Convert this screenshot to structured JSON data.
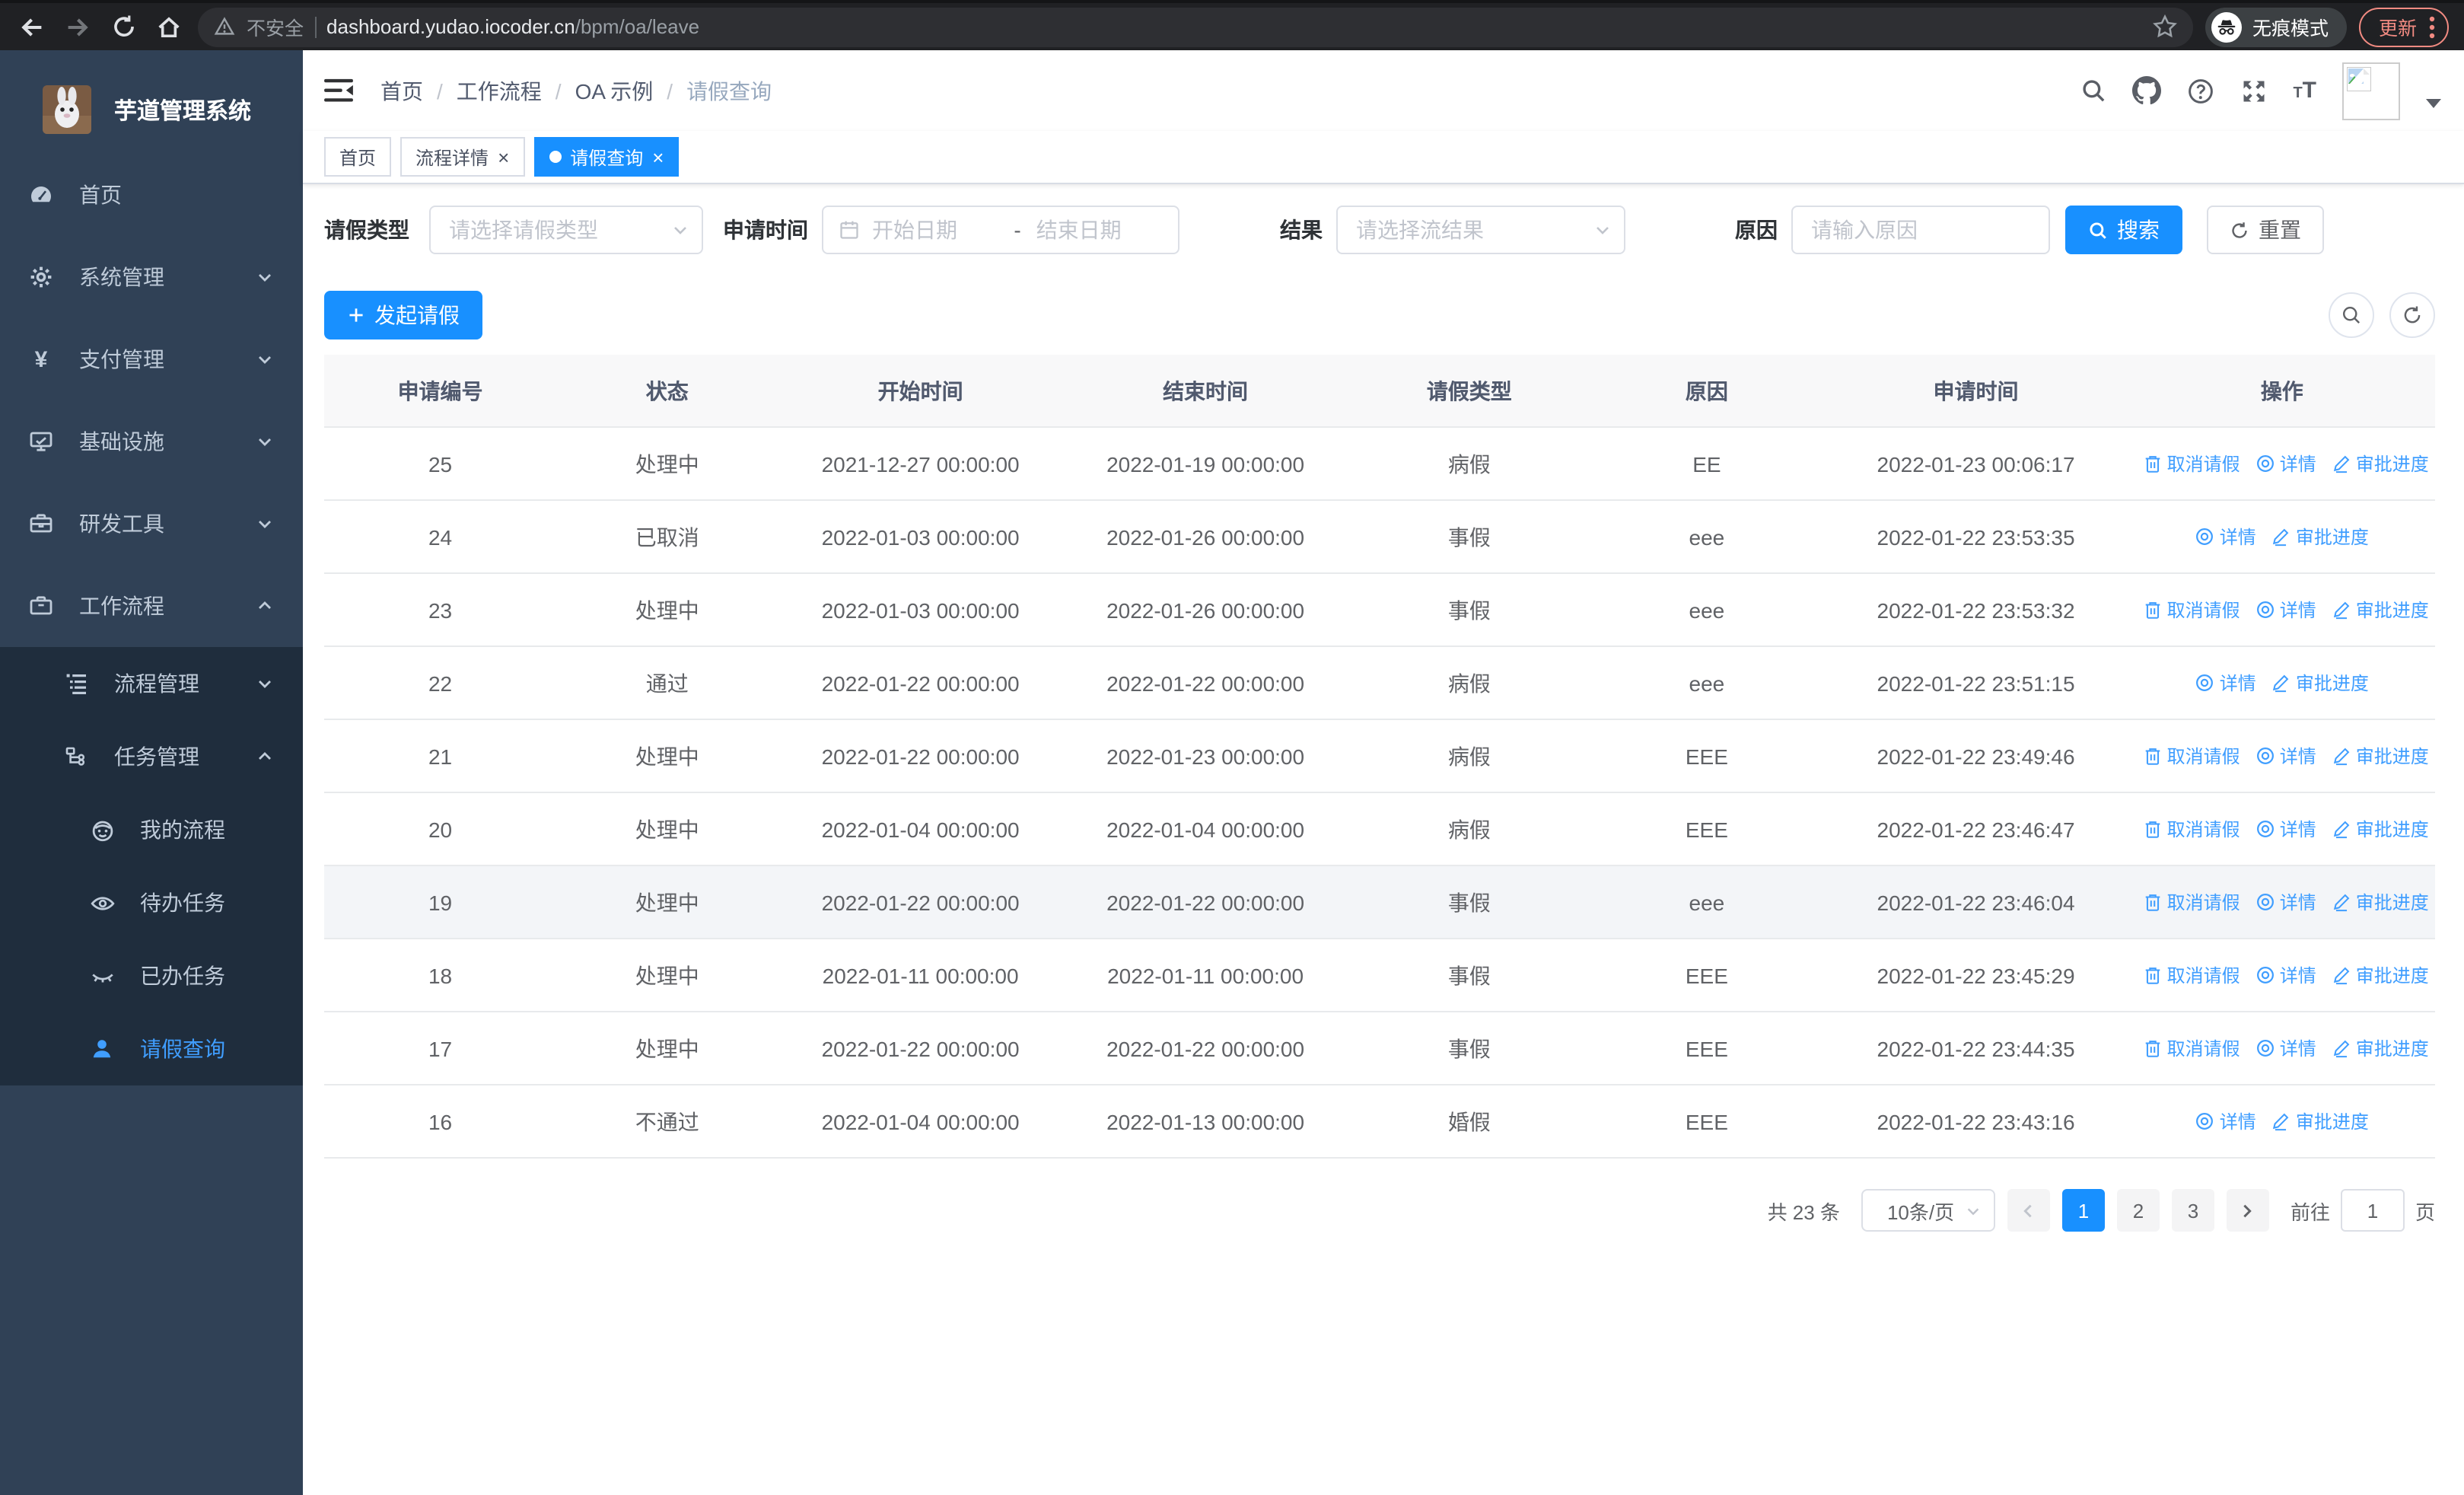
{
  "browser": {
    "security_label": "不安全",
    "url_host": "dashboard.yudao.iocoder.cn",
    "url_path": "/bpm/oa/leave",
    "incognito_label": "无痕模式",
    "update_label": "更新"
  },
  "colors": {
    "primary": "#1890ff",
    "link": "#409eff",
    "sidebar_bg": "#304156",
    "submenu_bg": "#1f2d3d",
    "sidebar_text": "#bfcbd9",
    "sidebar_active": "#409eff",
    "update_badge": "#f28b82",
    "table_header_bg": "#f8f8f9"
  },
  "sidebar": {
    "logo_title": "芋道管理系统",
    "menu": [
      {
        "key": "home",
        "label": "首页",
        "icon": "dashboard-icon",
        "level": 1
      },
      {
        "key": "system",
        "label": "系统管理",
        "icon": "gear-icon",
        "level": 1,
        "chevron": "down"
      },
      {
        "key": "payment",
        "label": "支付管理",
        "icon": "yen-icon",
        "level": 1,
        "chevron": "down"
      },
      {
        "key": "infra",
        "label": "基础设施",
        "icon": "monitor-icon",
        "level": 1,
        "chevron": "down"
      },
      {
        "key": "devtools",
        "label": "研发工具",
        "icon": "toolbox-icon",
        "level": 1,
        "chevron": "down"
      },
      {
        "key": "workflow",
        "label": "工作流程",
        "icon": "briefcase-icon",
        "level": 1,
        "chevron": "up"
      },
      {
        "key": "process-mgmt",
        "label": "流程管理",
        "icon": "list-icon",
        "level": 2,
        "sub": true,
        "chevron": "down"
      },
      {
        "key": "task-mgmt",
        "label": "任务管理",
        "icon": "tree-icon",
        "level": 2,
        "sub": true,
        "chevron": "up"
      },
      {
        "key": "my-process",
        "label": "我的流程",
        "icon": "robot-icon",
        "level": 3,
        "sub": true
      },
      {
        "key": "todo-tasks",
        "label": "待办任务",
        "icon": "eye-icon",
        "level": 3,
        "sub": true
      },
      {
        "key": "done-tasks",
        "label": "已办任务",
        "icon": "eye-closed-icon",
        "level": 3,
        "sub": true
      },
      {
        "key": "leave-query",
        "label": "请假查询",
        "icon": "user-icon",
        "level": 3,
        "sub": true,
        "active": true
      }
    ]
  },
  "header": {
    "breadcrumb": [
      "首页",
      "工作流程",
      "OA 示例",
      "请假查询"
    ]
  },
  "tabs": [
    {
      "label": "首页",
      "closable": false,
      "active": false
    },
    {
      "label": "流程详情",
      "closable": true,
      "active": false
    },
    {
      "label": "请假查询",
      "closable": true,
      "active": true
    }
  ],
  "filters": {
    "leave_type_label": "请假类型",
    "leave_type_placeholder": "请选择请假类型",
    "apply_time_label": "申请时间",
    "start_date_placeholder": "开始日期",
    "range_separator": "-",
    "end_date_placeholder": "结束日期",
    "result_label": "结果",
    "result_placeholder": "请选择流结果",
    "reason_label": "原因",
    "reason_placeholder": "请输入原因",
    "search_label": "搜索",
    "reset_label": "重置"
  },
  "toolbar": {
    "create_label": "发起请假"
  },
  "table": {
    "columns": [
      "申请编号",
      "状态",
      "开始时间",
      "结束时间",
      "请假类型",
      "原因",
      "申请时间",
      "操作"
    ],
    "action_labels": {
      "cancel": "取消请假",
      "detail": "详情",
      "progress": "审批进度"
    },
    "rows": [
      {
        "id": "25",
        "status": "处理中",
        "start": "2021-12-27 00:00:00",
        "end": "2022-01-19 00:00:00",
        "type": "病假",
        "reason": "EE",
        "apply_time": "2022-01-23 00:06:17",
        "actions": [
          "cancel",
          "detail",
          "progress"
        ]
      },
      {
        "id": "24",
        "status": "已取消",
        "start": "2022-01-03 00:00:00",
        "end": "2022-01-26 00:00:00",
        "type": "事假",
        "reason": "eee",
        "apply_time": "2022-01-22 23:53:35",
        "actions": [
          "detail",
          "progress"
        ]
      },
      {
        "id": "23",
        "status": "处理中",
        "start": "2022-01-03 00:00:00",
        "end": "2022-01-26 00:00:00",
        "type": "事假",
        "reason": "eee",
        "apply_time": "2022-01-22 23:53:32",
        "actions": [
          "cancel",
          "detail",
          "progress"
        ]
      },
      {
        "id": "22",
        "status": "通过",
        "start": "2022-01-22 00:00:00",
        "end": "2022-01-22 00:00:00",
        "type": "病假",
        "reason": "eee",
        "apply_time": "2022-01-22 23:51:15",
        "actions": [
          "detail",
          "progress"
        ]
      },
      {
        "id": "21",
        "status": "处理中",
        "start": "2022-01-22 00:00:00",
        "end": "2022-01-23 00:00:00",
        "type": "病假",
        "reason": "EEE",
        "apply_time": "2022-01-22 23:49:46",
        "actions": [
          "cancel",
          "detail",
          "progress"
        ]
      },
      {
        "id": "20",
        "status": "处理中",
        "start": "2022-01-04 00:00:00",
        "end": "2022-01-04 00:00:00",
        "type": "病假",
        "reason": "EEE",
        "apply_time": "2022-01-22 23:46:47",
        "actions": [
          "cancel",
          "detail",
          "progress"
        ]
      },
      {
        "id": "19",
        "status": "处理中",
        "start": "2022-01-22 00:00:00",
        "end": "2022-01-22 00:00:00",
        "type": "事假",
        "reason": "eee",
        "apply_time": "2022-01-22 23:46:04",
        "actions": [
          "cancel",
          "detail",
          "progress"
        ],
        "highlight": true
      },
      {
        "id": "18",
        "status": "处理中",
        "start": "2022-01-11 00:00:00",
        "end": "2022-01-11 00:00:00",
        "type": "事假",
        "reason": "EEE",
        "apply_time": "2022-01-22 23:45:29",
        "actions": [
          "cancel",
          "detail",
          "progress"
        ]
      },
      {
        "id": "17",
        "status": "处理中",
        "start": "2022-01-22 00:00:00",
        "end": "2022-01-22 00:00:00",
        "type": "事假",
        "reason": "EEE",
        "apply_time": "2022-01-22 23:44:35",
        "actions": [
          "cancel",
          "detail",
          "progress"
        ]
      },
      {
        "id": "16",
        "status": "不通过",
        "start": "2022-01-04 00:00:00",
        "end": "2022-01-13 00:00:00",
        "type": "婚假",
        "reason": "EEE",
        "apply_time": "2022-01-22 23:43:16",
        "actions": [
          "detail",
          "progress"
        ]
      }
    ]
  },
  "pagination": {
    "total_label": "共 23 条",
    "page_size_label": "10条/页",
    "pages": [
      "1",
      "2",
      "3"
    ],
    "active_page": "1",
    "goto_label": "前往",
    "goto_value": "1",
    "page_unit_label": "页"
  }
}
